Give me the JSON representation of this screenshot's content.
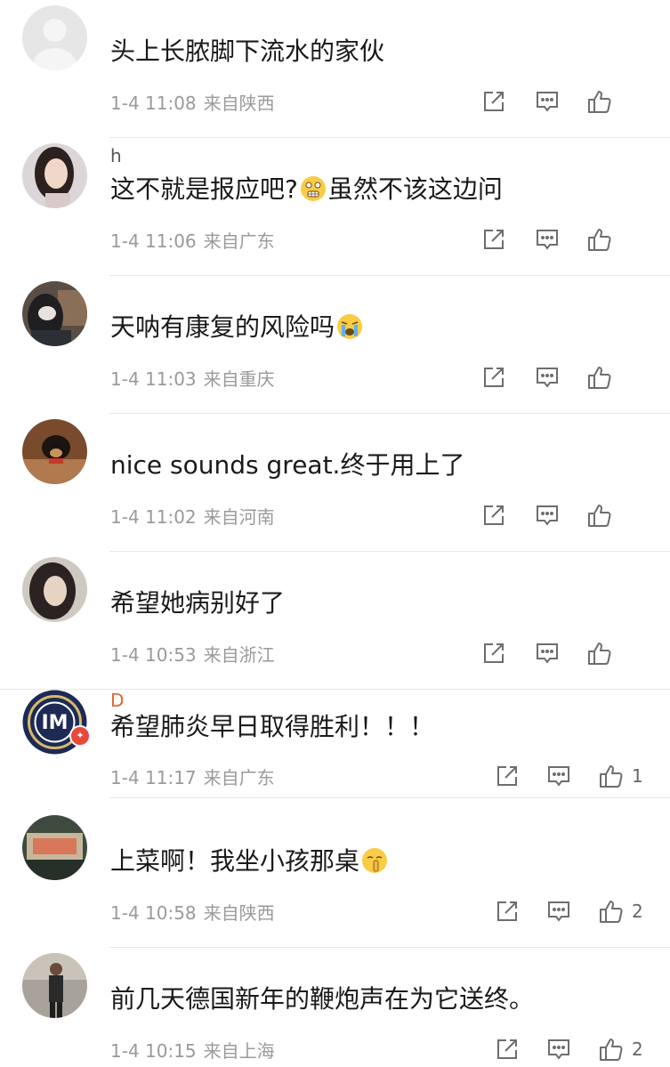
{
  "comments": [
    {
      "username": "",
      "text": "头上长脓脚下流水的家伙",
      "date": "1-4 11:08",
      "location": "来自陕西",
      "likes": "",
      "avatar": "default"
    },
    {
      "username": "h",
      "text_before": "这不就是报应吧?",
      "emoji": "shocked-face",
      "text_after": "虽然不该这边问",
      "date": "1-4 11:06",
      "location": "来自广东",
      "likes": "",
      "avatar": "girl-photo"
    },
    {
      "username": "",
      "text_before": "天呐有康复的风险吗",
      "emoji": "crying-face",
      "text_after": "",
      "date": "1-4 11:03",
      "location": "来自重庆",
      "likes": "",
      "avatar": "dark-hood-photo"
    },
    {
      "username": "",
      "text": "nice  sounds great.终于用上了",
      "date": "1-4 11:02",
      "location": "来自河南",
      "likes": "",
      "avatar": "dog-photo"
    },
    {
      "username": "",
      "text": "希望她病别好了",
      "date": "1-4 10:53",
      "location": "来自浙江",
      "likes": "",
      "avatar": "portrait-photo"
    },
    {
      "username": "D",
      "text": "希望肺炎早日取得胜利！！！",
      "date": "1-4 11:17",
      "location": "来自广东",
      "likes": "1",
      "avatar": "inter-logo"
    },
    {
      "username": "",
      "text_before": "上菜啊！我坐小孩那桌",
      "emoji": "shush-face",
      "text_after": "",
      "date": "1-4 10:58",
      "location": "来自陕西",
      "likes": "2",
      "avatar": "building-photo"
    },
    {
      "username": "",
      "text": "前几天德国新年的鞭炮声在为它送终。",
      "date": "1-4 10:15",
      "location": "来自上海",
      "likes": "2",
      "avatar": "man-photo"
    }
  ],
  "icons": {
    "share": "share-icon",
    "reply": "comment-icon",
    "like": "thumbs-up-icon"
  },
  "colors": {
    "meta_text": "#9a9a9a",
    "divider": "#e8e8e8",
    "badge": "#e9483a"
  }
}
